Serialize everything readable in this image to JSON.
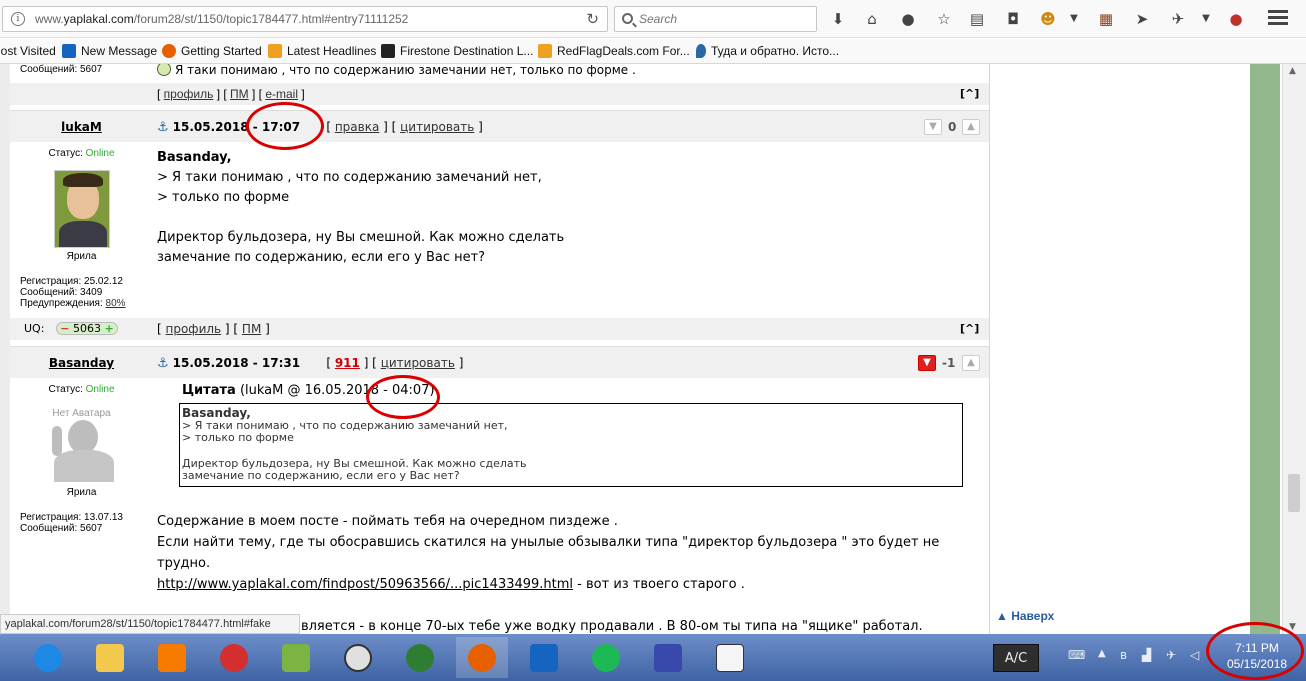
{
  "browser": {
    "url_prefix": "www.",
    "url_domain": "yaplakal.com",
    "url_rest": "/forum28/st/1150/topic1784477.html#entry71111252",
    "search_placeholder": "Search"
  },
  "bookmarks": [
    {
      "label": "lost Visited",
      "color": "#ffffff"
    },
    {
      "label": "New Message",
      "color": "#1565c0"
    },
    {
      "label": "Getting Started",
      "color": "#e66000"
    },
    {
      "label": "Latest Headlines",
      "color": "#f0a020"
    },
    {
      "label": "Firestone Destination L...",
      "color": "#222222"
    },
    {
      "label": "RedFlagDeals.com For...",
      "color": "#f0a020"
    },
    {
      "label": "Туда и обратно. Исто...",
      "color": "#2a6aa3"
    }
  ],
  "prev_post": {
    "smiley_text": "Я таки понимаю , что по содержанию замечании нет, только по форме .",
    "links": [
      "профиль",
      "ПМ",
      "e-mail"
    ],
    "up": "[^]"
  },
  "post1": {
    "author": "lukaM",
    "date": "15.05.2018",
    "time": "17:07",
    "actions": [
      "правка",
      "цитировать"
    ],
    "rating": "0",
    "status_label": "Статус:",
    "status": "Online",
    "user_title": "Ярила",
    "reg_label": "Регистрация:",
    "reg": "25.02.12",
    "posts_label": "Сообщений:",
    "posts": "3409",
    "warn_label": "Предупреждения:",
    "warn": "80%",
    "uq_label": "UQ:",
    "uq": "5063",
    "addressee": "Basanday,",
    "lines": [
      "> Я таки понимаю , что по содержанию замечаний нет,",
      "> только по форме",
      "Директор бульдозера, ну Вы смешной. Как можно сделать",
      "замечание по содержанию, если его у Вас нет?"
    ],
    "footer_links": [
      "профиль",
      "ПМ"
    ],
    "up": "[^]"
  },
  "post2": {
    "author": "Basanday",
    "date": "15.05.2018",
    "time": "17:31",
    "rating_link": "911",
    "actions": [
      "цитировать"
    ],
    "rating": "-1",
    "status_label": "Статус:",
    "status": "Online",
    "no_avatar": "Нет Аватара",
    "user_title": "Ярила",
    "reg_label": "Регистрация:",
    "reg": "13.07.13",
    "posts_label": "Сообщений:",
    "posts": "5607",
    "quote_title": "Цитата",
    "quote_meta": "(lukaM @ 16.05.2018 - 04:07)",
    "quote_addressee": "Basanday,",
    "quote_lines": [
      "> Я таки понимаю , что по содержанию замечаний нет,",
      "> только по форме",
      "Директор бульдозера, ну Вы смешной. Как можно сделать",
      "замечание по содержанию, если его у Вас нет?"
    ],
    "body_lines": [
      "Содержание в моем посте - поймать тебя на очередном пиздеже .",
      "Если найти тему, где ты обосравшись скатился на унылые обзывалки типа \"директор бульдозера \" это будет не",
      "трудно."
    ],
    "link": "http://www.yaplakal.com/findpost/50963566/...pic1433499.html",
    "link_suffix": " - вот из твоего старого .",
    "last_line": "авляется - в конце 70-ых тебе уже водку продавали . В 80-ом ты типа на \"ящике\" работал."
  },
  "sidebar_prev_posts": "Сообщений: 5607",
  "naverh": "Наверх",
  "status_url": "yaplakal.com/forum28/st/1150/topic1784477.html#fake",
  "taskbar": {
    "ac_label": "A/C",
    "time": "7:11 PM",
    "date": "05/15/2018"
  }
}
